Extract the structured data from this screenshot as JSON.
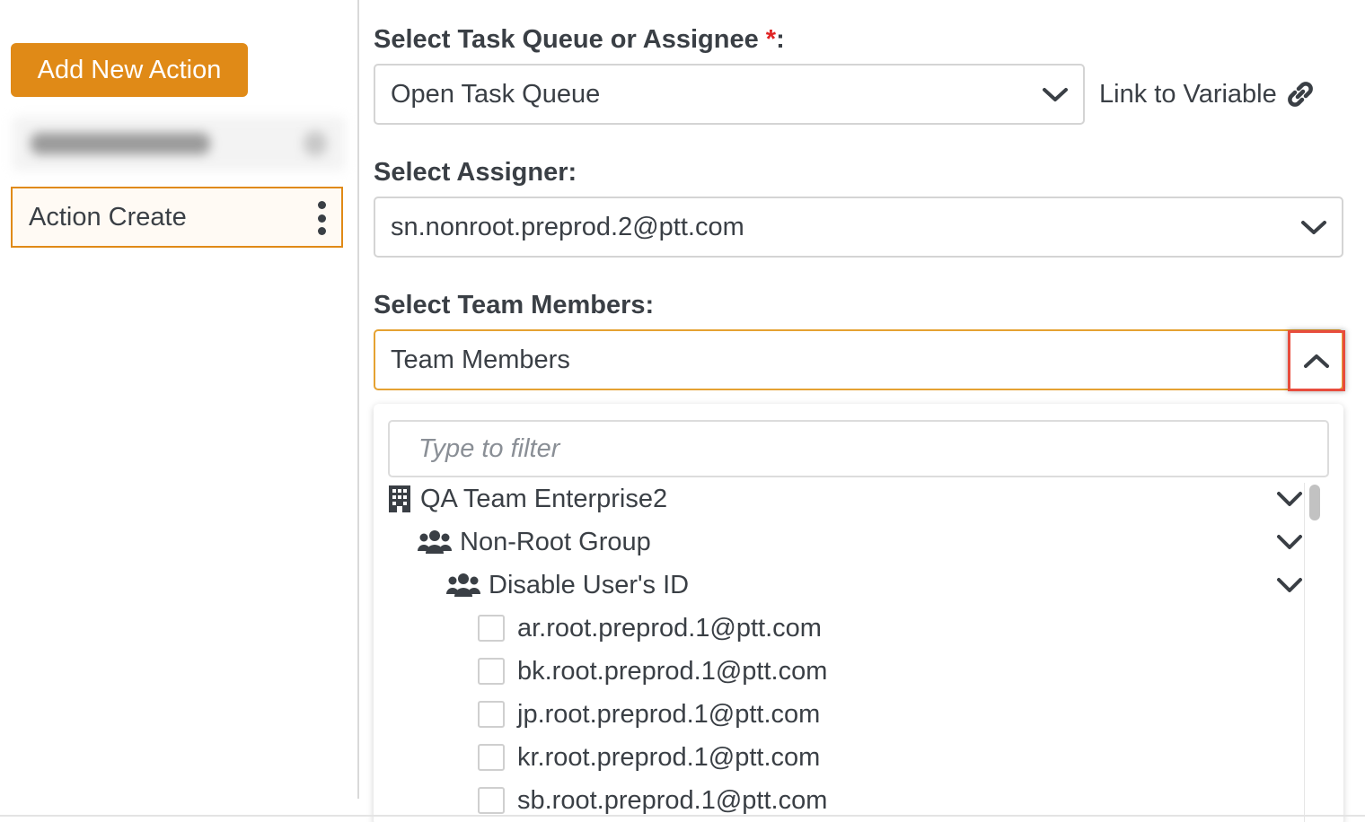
{
  "sidebar": {
    "add_button": "Add New Action",
    "items": [
      {
        "label": "Action Create",
        "selected": true,
        "menu_icon": "kebab-menu-icon"
      }
    ]
  },
  "form": {
    "queue": {
      "label": "Select Task Queue or Assignee",
      "required_mark": "*",
      "colon": ":",
      "value": "Open Task Queue",
      "link_label": "Link to Variable",
      "link_icon": "link-icon"
    },
    "assigner": {
      "label": "Select Assigner:",
      "value": "sn.nonroot.preprod.2@ptt.com"
    },
    "team": {
      "label": "Select Team Members:",
      "value": "Team Members",
      "filter_placeholder": "Type to filter",
      "tree": [
        {
          "label": "QA Team Enterprise2",
          "icon": "building-icon",
          "level": 0
        },
        {
          "label": "Non-Root Group",
          "icon": "users-icon",
          "level": 1
        },
        {
          "label": "Disable User's ID",
          "icon": "users-icon",
          "level": 2
        }
      ],
      "members": [
        "ar.root.preprod.1@ptt.com",
        "bk.root.preprod.1@ptt.com",
        "jp.root.preprod.1@ptt.com",
        "kr.root.preprod.1@ptt.com",
        "sb.root.preprod.1@ptt.com"
      ]
    }
  },
  "colors": {
    "accent": "#e08a17",
    "highlight_box": "#e84c3d",
    "required": "#e02424"
  }
}
